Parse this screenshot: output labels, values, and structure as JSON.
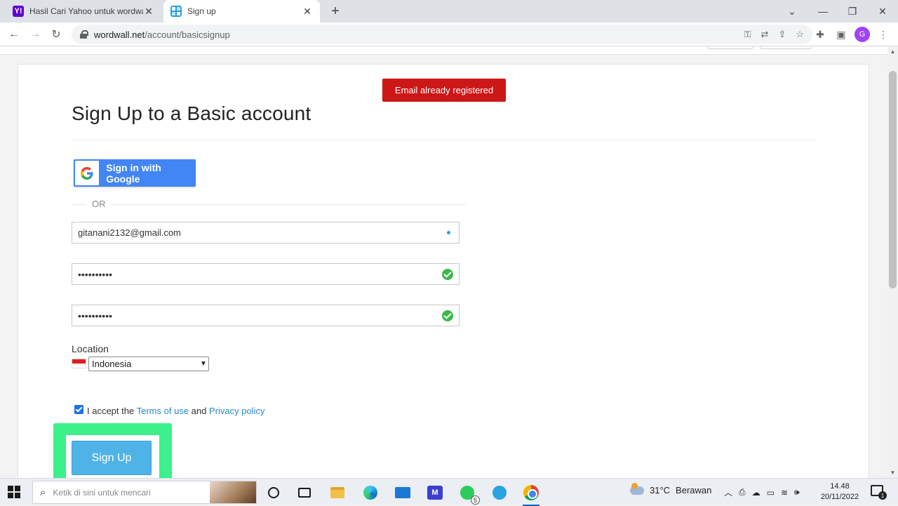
{
  "browser": {
    "tabs": [
      {
        "title": "Hasil Cari Yahoo untuk wordwall",
        "favicon": "Y!",
        "active": false
      },
      {
        "title": "Sign up",
        "favicon": "wordwall-icon",
        "active": true
      }
    ],
    "new_tab": "+",
    "address": {
      "host": "wordwall.net",
      "path": "/account/basicsignup"
    },
    "profile_initial": "G"
  },
  "page": {
    "alert": "Email already registered",
    "heading": "Sign Up to a Basic account",
    "google_button": "Sign in with Google",
    "or_text": "OR",
    "email_value": "gitanani2132@gmail.com",
    "password_mask": "••••••••••",
    "confirm_mask": "••••••••••",
    "location_label": "Location",
    "location_value": "Indonesia",
    "terms": {
      "prefix": "I accept the",
      "terms_link": "Terms of use",
      "and": "and",
      "privacy_link": "Privacy policy",
      "checked": true
    },
    "signup_button": "Sign Up"
  },
  "taskbar": {
    "search_placeholder": "Ketik di sini untuk mencari",
    "whatsapp_badge": "5",
    "weather": {
      "temp": "31°C",
      "condition": "Berawan"
    },
    "clock": {
      "time": "14.48",
      "date": "20/11/2022"
    },
    "notification_count": "1"
  },
  "colors": {
    "alert": "#cc1717",
    "google_blue": "#4285f4",
    "signup_button": "#4fb3e8",
    "highlight": "#3cf08a",
    "link": "#2a8ac4",
    "valid": "#3cb84a"
  }
}
